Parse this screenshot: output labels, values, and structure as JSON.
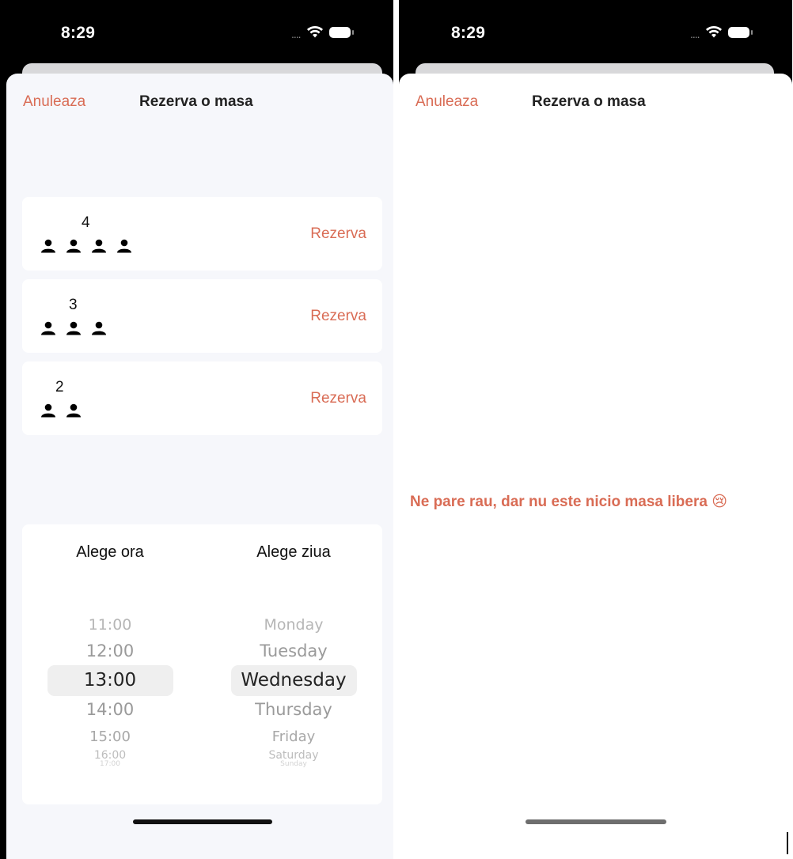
{
  "status_bar": {
    "time": "8:29",
    "signal": "....",
    "signal_icon": "signal-dots-icon",
    "wifi_icon": "wifi-icon",
    "battery_icon": "battery-icon"
  },
  "left_screen": {
    "cancel_label": "Anuleaza",
    "title": "Rezerva o masa",
    "tables": [
      {
        "count": "4",
        "seats": 4,
        "reserve_label": "Rezerva"
      },
      {
        "count": "3",
        "seats": 3,
        "reserve_label": "Rezerva"
      },
      {
        "count": "2",
        "seats": 2,
        "reserve_label": "Rezerva"
      }
    ],
    "picker": {
      "hour_label": "Alege ora",
      "day_label": "Alege ziua",
      "hours": [
        "11:00",
        "12:00",
        "13:00",
        "14:00",
        "15:00",
        "16:00",
        "17:00"
      ],
      "selected_hour": "13:00",
      "days": [
        "Monday",
        "Tuesday",
        "Wednesday",
        "Thursday",
        "Friday",
        "Saturday",
        "Sunday"
      ],
      "selected_day": "Wednesday"
    }
  },
  "right_screen": {
    "cancel_label": "Anuleaza",
    "title": "Rezerva o masa",
    "empty_message": "Ne pare rau, dar nu este nicio masa libera 😢"
  },
  "colors": {
    "accent": "#d96c55",
    "sheet_bg": "#f6f7fb",
    "card_bg": "#ffffff",
    "status_bar_bg": "#000000"
  }
}
